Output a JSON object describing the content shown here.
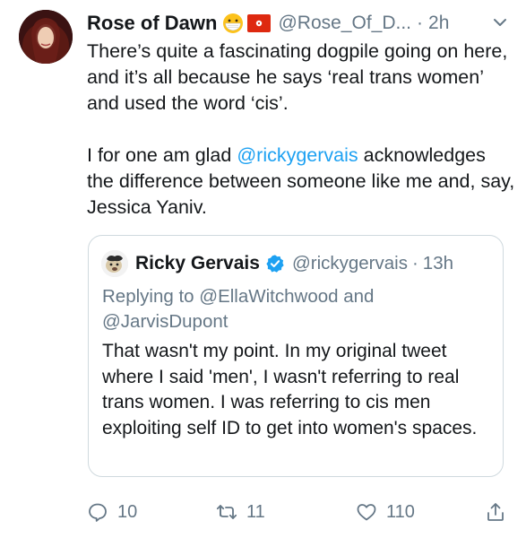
{
  "tweet": {
    "author_name": "Rose of Dawn",
    "handle": "@Rose_Of_D...",
    "separator": "·",
    "time": "2h",
    "paragraph1": "There’s quite a fascinating dogpile going on here, and it’s all because he says ‘real trans women’ and used the word ‘cis’.",
    "paragraph2_prefix": "I for one am glad ",
    "paragraph2_mention": "@rickygervais",
    "paragraph2_suffix": " acknowledges the difference between someone like me and, say, Jessica Yaniv."
  },
  "quoted": {
    "author_name": "Ricky Gervais",
    "handle": "@rickygervais",
    "separator": "·",
    "time": "13h",
    "replying_prefix": "Replying to ",
    "replying_user1": "@EllaWitchwood",
    "replying_and": " and ",
    "replying_user2": "@JarvisDupont",
    "text": "That wasn't my point. In my original tweet where I said 'men', I wasn't referring to real trans women. I was referring to cis men exploiting self ID to get into women's spaces."
  },
  "actions": {
    "reply_count": "10",
    "retweet_count": "11",
    "like_count": "110"
  },
  "colors": {
    "link": "#1da1f2",
    "muted": "#657786",
    "text": "#14171a",
    "border": "#cfd9de"
  },
  "icons": [
    "caret-down-icon",
    "reply-icon",
    "retweet-icon",
    "like-icon",
    "share-icon",
    "verified-icon",
    "mask-emoji-icon",
    "hong-kong-flag-icon"
  ]
}
